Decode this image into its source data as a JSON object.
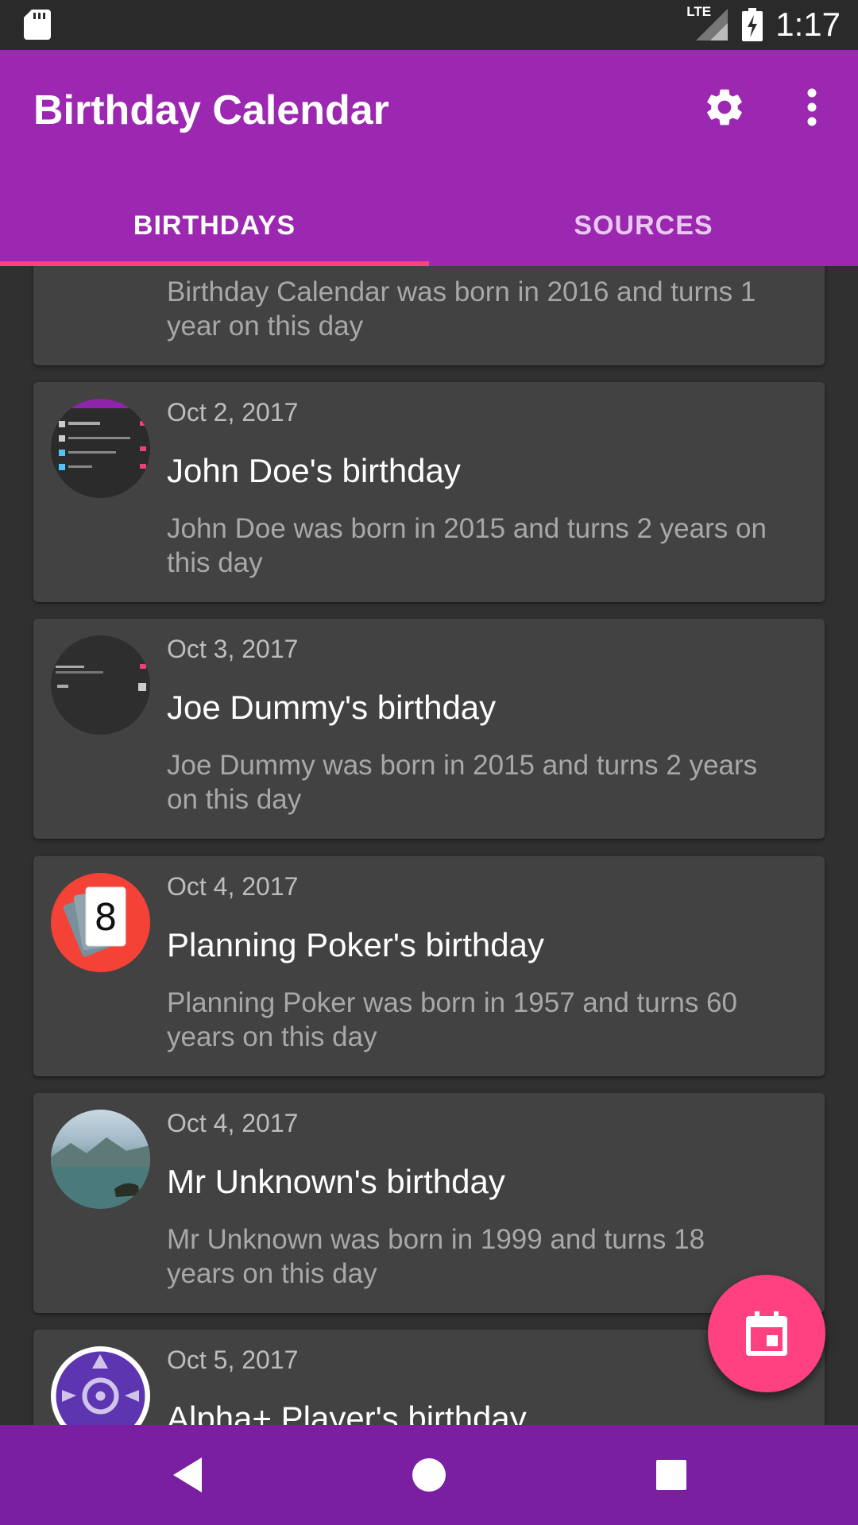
{
  "status_bar": {
    "network": "LTE",
    "time": "1:17"
  },
  "app_bar": {
    "title": "Birthday Calendar"
  },
  "tabs": [
    {
      "label": "BIRTHDAYS",
      "selected": true
    },
    {
      "label": "SOURCES",
      "selected": false
    }
  ],
  "birthdays": [
    {
      "date": "",
      "title": "",
      "description": "Birthday Calendar was born in 2016 and turns 1 year on this day"
    },
    {
      "date": "Oct 2, 2017",
      "title": "John Doe's birthday",
      "description": "John Doe was born in 2015 and turns 2 years on this day"
    },
    {
      "date": "Oct 3, 2017",
      "title": "Joe Dummy's birthday",
      "description": "Joe Dummy was born in 2015 and turns 2 years on this day"
    },
    {
      "date": "Oct 4, 2017",
      "title": "Planning Poker's birthday",
      "description": "Planning Poker was born in 1957 and turns 60 years on this day"
    },
    {
      "date": "Oct 4, 2017",
      "title": "Mr Unknown's birthday",
      "description": "Mr Unknown was born in 1999 and turns 18 years on this day"
    },
    {
      "date": "Oct 5, 2017",
      "title": "Alpha+ Player's birthday",
      "description": ""
    }
  ],
  "avatars": {
    "planning_poker_card": "8"
  },
  "fab": {
    "icon": "calendar-icon"
  },
  "colors": {
    "primary": "#9c27b0",
    "accent": "#ff4081",
    "nav": "#7b1fa2",
    "card": "#424242",
    "background": "#303030"
  }
}
